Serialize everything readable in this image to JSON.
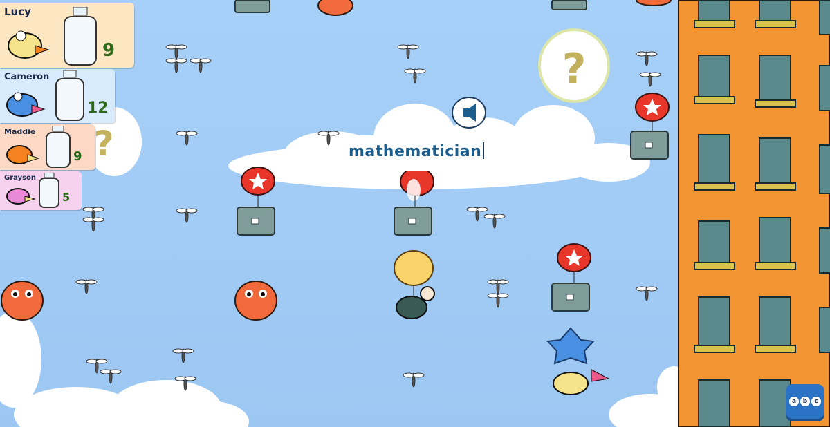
{
  "leaderboard": [
    {
      "name": "Lucy",
      "score": "9",
      "color": "#fde6c2"
    },
    {
      "name": "Cameron",
      "score": "12",
      "color": "#d8ebfd"
    },
    {
      "name": "Maddie",
      "score": "9",
      "color": "#fbd9c4"
    },
    {
      "name": "Grayson",
      "score": "5",
      "color": "#f6d2ee"
    }
  ],
  "word_input": {
    "value": "mathematician"
  },
  "buttons": {
    "audio": "speaker-icon",
    "hint": "question-mark-icon",
    "keyboard_letters": [
      "a",
      "b",
      "c"
    ]
  },
  "hint_symbol": "?",
  "colors": {
    "sky": "#9ec9f4",
    "building": "#f39433",
    "balloon_red": "#e8372a",
    "box": "#7f9b9a",
    "monster": "#f06a3c"
  }
}
